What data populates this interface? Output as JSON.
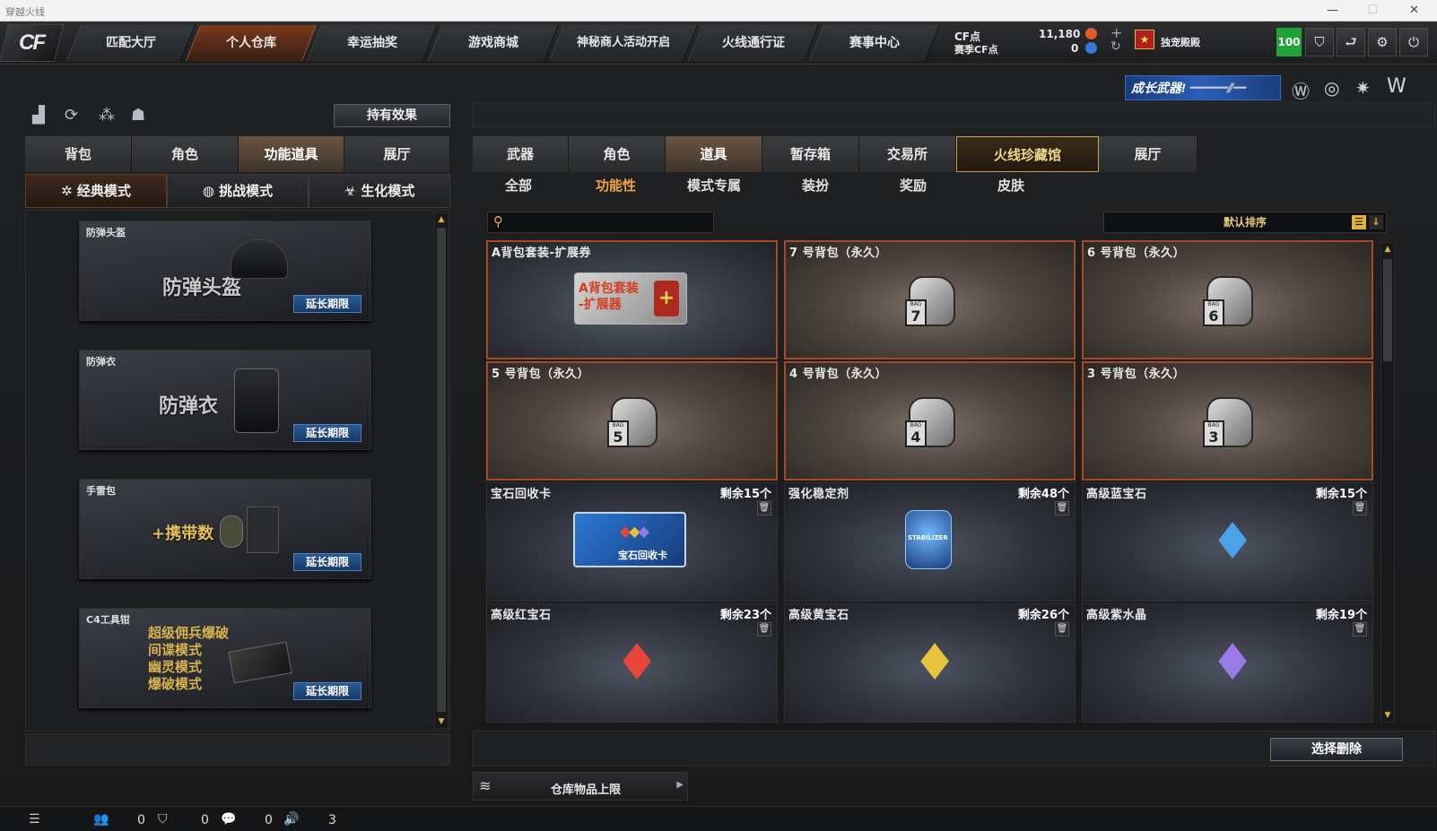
{
  "window": {
    "title": "穿越火线"
  },
  "nav": {
    "tabs": [
      "匹配大厅",
      "个人仓库",
      "幸运抽奖",
      "游戏商城",
      "神秘商人活动开启",
      "火线通行证",
      "赛事中心"
    ],
    "cf_label": "CF点",
    "season_cf_label": "赛季CF点",
    "cf_value": "11,180",
    "season_cf_value": "0",
    "vip_label": "独宠殿殿",
    "level": "100"
  },
  "banner": {
    "text": "成长武器!"
  },
  "left": {
    "effect_button": "持有效果",
    "tabs": [
      "背包",
      "角色",
      "功能道具",
      "展厅"
    ],
    "modes": [
      "经典模式",
      "挑战模式",
      "生化模式"
    ],
    "items": [
      {
        "name": "防弹头盔",
        "art": "防弹头盔",
        "action": "延长期限"
      },
      {
        "name": "防弹衣",
        "art": "防弹衣",
        "action": "延长期限"
      },
      {
        "name": "手雷包",
        "art": "+携带数",
        "action": "延长期限"
      },
      {
        "name": "C4工具钳",
        "art_lines": [
          "超级佣兵爆破",
          "间谍模式",
          "幽灵模式",
          "爆破模式"
        ],
        "action": "延长期限"
      }
    ]
  },
  "right": {
    "tabs": [
      "武器",
      "角色",
      "道具",
      "暂存箱",
      "交易所",
      "火线珍藏馆",
      "展厅"
    ],
    "subtabs": [
      "全部",
      "功能性",
      "模式专属",
      "装扮",
      "奖励",
      "皮肤"
    ],
    "sort_label": "默认排序",
    "items": [
      {
        "name": "A背包套装-扩展券",
        "art_lines": [
          "A背包套装",
          "-扩展器"
        ]
      },
      {
        "name": "7 号背包（永久）",
        "bag": "7"
      },
      {
        "name": "6 号背包（永久）",
        "bag": "6"
      },
      {
        "name": "5 号背包（永久）",
        "bag": "5"
      },
      {
        "name": "4 号背包（永久）",
        "bag": "4"
      },
      {
        "name": "3 号背包（永久）",
        "bag": "3"
      },
      {
        "name": "宝石回收卡",
        "count": "剩余15个",
        "art": "宝石回收卡"
      },
      {
        "name": "强化稳定剂",
        "count": "剩余48个",
        "art": "STABILIZER"
      },
      {
        "name": "高级蓝宝石",
        "count": "剩余15个",
        "color": "#4aa3e8"
      },
      {
        "name": "高级红宝石",
        "count": "剩余23个",
        "color": "#e8463a"
      },
      {
        "name": "高级黄宝石",
        "count": "剩余26个",
        "color": "#e8c23a"
      },
      {
        "name": "高级紫水晶",
        "count": "剩余19个",
        "color": "#9a7ae8"
      }
    ],
    "delete_button": "选择删除",
    "capacity_label": "仓库物品上限"
  },
  "status": {
    "count1": "0",
    "count2": "0",
    "count3": "0",
    "count4": "3"
  },
  "colors": {
    "accent_orange": "#f0a445",
    "border_orange": "#a64a26",
    "gold": "#c8a24a",
    "extend_blue": "#2a5a95",
    "level_green": "#1fa43a"
  }
}
